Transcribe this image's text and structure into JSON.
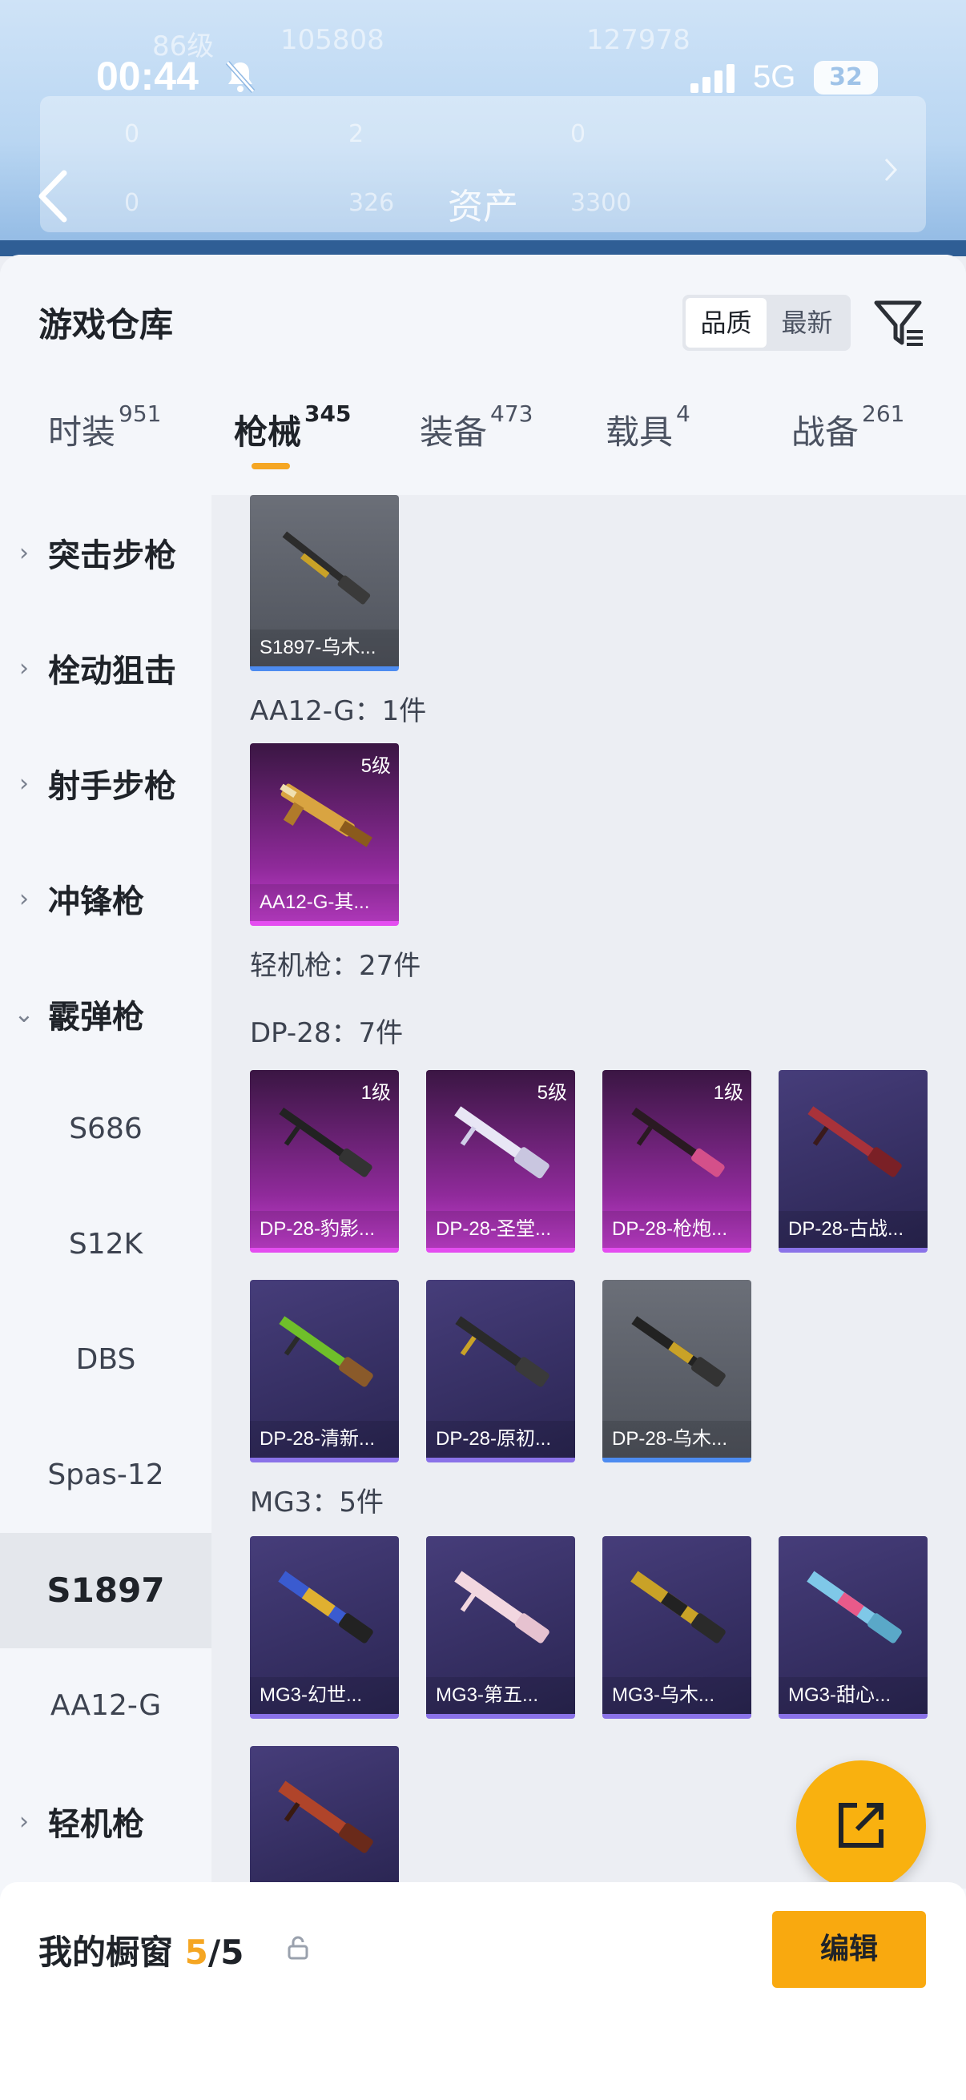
{
  "status_bar": {
    "time": "00:44",
    "network": "5G",
    "battery": "32"
  },
  "header": {
    "title": "资产",
    "faint_level": "86级",
    "faint_coins": "105808",
    "faint_points": "127978",
    "faint_stats": [
      "0",
      "2",
      "0",
      "0",
      "326",
      "3300"
    ]
  },
  "sheet": {
    "title": "游戏仓库",
    "sort_options": [
      "品质",
      "最新"
    ],
    "active_sort": "品质"
  },
  "tabs": [
    {
      "label": "时装",
      "count": "951"
    },
    {
      "label": "枪械",
      "count": "345"
    },
    {
      "label": "装备",
      "count": "473"
    },
    {
      "label": "载具",
      "count": "4"
    },
    {
      "label": "战备",
      "count": "261"
    }
  ],
  "sidebar": {
    "categories": [
      {
        "label": "突击步枪"
      },
      {
        "label": "栓动狙击"
      },
      {
        "label": "射手步枪"
      },
      {
        "label": "冲锋枪"
      },
      {
        "label": "霰弹枪"
      }
    ],
    "subitems": [
      "S686",
      "S12K",
      "DBS",
      "Spas-12",
      "S1897",
      "AA12-G"
    ],
    "active_subitem": "S1897",
    "next_category": "轻机枪"
  },
  "content": {
    "top_card": {
      "name": "S1897-乌木...",
      "rarity": "grey"
    },
    "aa12_header": "AA12-G：1件",
    "aa12_card": {
      "name": "AA12-G-其...",
      "level": "5级",
      "rarity": "pink"
    },
    "lmg_header": "轻机枪：27件",
    "dp28_header": "DP-28：7件",
    "dp28_cards": [
      {
        "name": "DP-28-豹影...",
        "level": "1级",
        "rarity": "pink"
      },
      {
        "name": "DP-28-圣堂...",
        "level": "5级",
        "rarity": "pink"
      },
      {
        "name": "DP-28-枪炮...",
        "level": "1级",
        "rarity": "pink"
      },
      {
        "name": "DP-28-古战...",
        "level": "",
        "rarity": "purple"
      },
      {
        "name": "DP-28-清新...",
        "level": "",
        "rarity": "purple"
      },
      {
        "name": "DP-28-原初...",
        "level": "",
        "rarity": "purple"
      },
      {
        "name": "DP-28-乌木...",
        "level": "",
        "rarity": "grey"
      }
    ],
    "mg3_header": "MG3：5件",
    "mg3_cards": [
      {
        "name": "MG3-幻世...",
        "rarity": "purple"
      },
      {
        "name": "MG3-第五...",
        "rarity": "purple"
      },
      {
        "name": "MG3-乌木...",
        "rarity": "purple"
      },
      {
        "name": "MG3-甜心...",
        "rarity": "purple"
      },
      {
        "name": "",
        "rarity": "purple"
      }
    ]
  },
  "bottom_bar": {
    "label": "我的橱窗",
    "count": "5",
    "total": "/5",
    "edit_label": "编辑"
  },
  "colors": {
    "accent": "#f9a90f",
    "pink_rarity": "#c53fd1",
    "purple_rarity": "#463d7a",
    "grey_rarity": "#5a5e67"
  }
}
